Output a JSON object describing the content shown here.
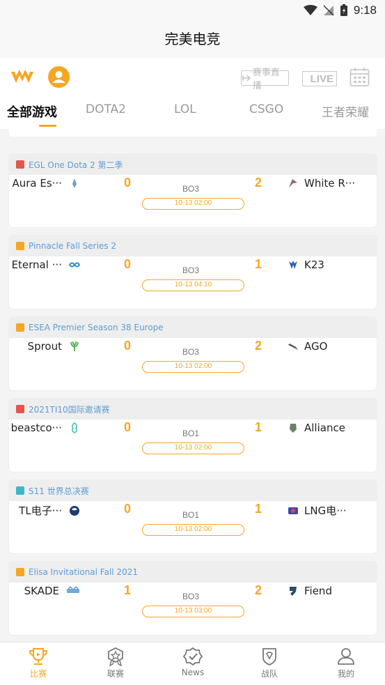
{
  "status_bar": {
    "time": "9:18"
  },
  "app": {
    "title": "完美电竞"
  },
  "toolbar": {
    "live_schedule_label": "赛事直播",
    "live_label": "LIVE"
  },
  "tabs": [
    {
      "label": "全部游戏",
      "active": true
    },
    {
      "label": "DOTA2",
      "active": false
    },
    {
      "label": "LOL",
      "active": false
    },
    {
      "label": "CSGO",
      "active": false
    },
    {
      "label": "王者荣耀",
      "active": false
    }
  ],
  "matches": [
    {
      "game": "dota2",
      "league": "EGL One Dota 2 第二季",
      "team_a": "Aura Es···",
      "score_a": "0",
      "format": "BO3",
      "score_b": "2",
      "team_b": "White R···",
      "time": "10-13 02:00"
    },
    {
      "game": "csgo",
      "league": "Pinnacle Fall Series 2",
      "team_a": "Eternal ···",
      "score_a": "0",
      "format": "BO3",
      "score_b": "1",
      "team_b": "K23",
      "time": "10-13 04:10"
    },
    {
      "game": "csgo",
      "league": "ESEA Premier Season 38 Europe",
      "team_a": "Sprout",
      "score_a": "0",
      "format": "BO3",
      "score_b": "2",
      "team_b": "AGO",
      "time": "10-13 02:00"
    },
    {
      "game": "dota2",
      "league": "2021TI10国际邀请赛",
      "team_a": "beastco···",
      "score_a": "0",
      "format": "BO1",
      "score_b": "1",
      "team_b": "Alliance",
      "time": "10-13 02:00"
    },
    {
      "game": "lol",
      "league": "S11 世界总决赛",
      "team_a": "TL电子···",
      "score_a": "0",
      "format": "BO1",
      "score_b": "1",
      "team_b": "LNG电···",
      "time": "10-13 02:00"
    },
    {
      "game": "csgo",
      "league": "Elisa Invitational Fall 2021",
      "team_a": "SKADE",
      "score_a": "1",
      "format": "BO3",
      "score_b": "2",
      "team_b": "Fiend",
      "time": "10-13 03:00"
    }
  ],
  "colors": {
    "accent": "#f5a623",
    "league_text": "#5d9dd5",
    "dota2": "#e2574c",
    "csgo": "#f5a623",
    "lol": "#3fb6c8"
  },
  "bottom_nav": [
    {
      "label": "比赛",
      "icon": "trophy-icon",
      "active": true
    },
    {
      "label": "联赛",
      "icon": "medal-icon",
      "active": false
    },
    {
      "label": "News",
      "icon": "news-badge-icon",
      "active": false
    },
    {
      "label": "战队",
      "icon": "shield-icon",
      "active": false
    },
    {
      "label": "我的",
      "icon": "user-icon",
      "active": false
    }
  ]
}
